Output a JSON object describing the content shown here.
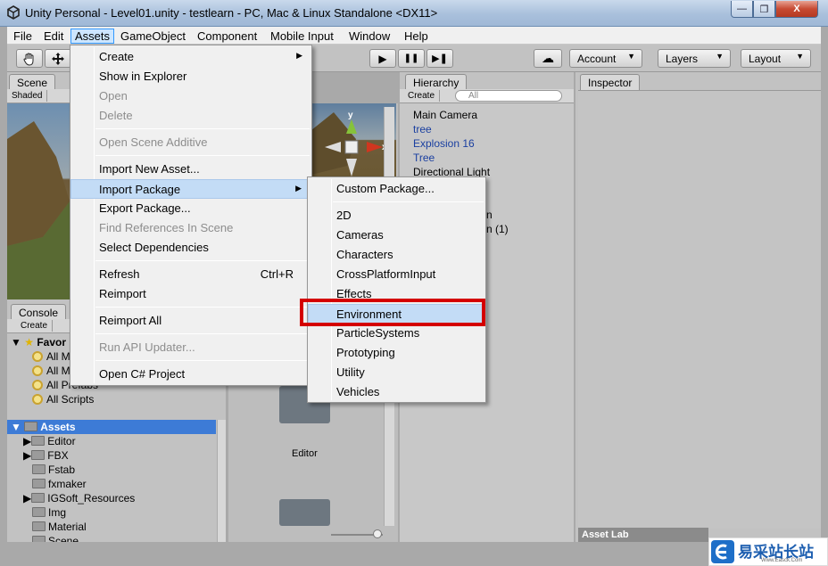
{
  "window": {
    "title": "Unity Personal - Level01.unity - testlearn - PC, Mac & Linux Standalone <DX11>",
    "min_label": "—",
    "max_label": "❐",
    "close_label": "X"
  },
  "menubar": [
    "File",
    "Edit",
    "Assets",
    "GameObject",
    "Component",
    "Mobile Input",
    "Window",
    "Help"
  ],
  "toolbar": {
    "play": "▶",
    "pause": "❚❚",
    "step": "▶❚",
    "cloud": "☁",
    "account": "Account",
    "layers": "Layers",
    "layout": "Layout"
  },
  "scene": {
    "tab": "Scene",
    "mode": "Shaded"
  },
  "gizmo": {
    "y": "y",
    "x": "x"
  },
  "hierarchy": {
    "tab": "Hierarchy",
    "create": "Create",
    "search_placeholder": "All",
    "items": [
      {
        "label": "Main Camera",
        "color": "#000000"
      },
      {
        "label": "tree",
        "color": "#1a3fa0"
      },
      {
        "label": "Explosion 16",
        "color": "#1a3fa0"
      },
      {
        "label": "Tree",
        "color": "#1a3fa0"
      },
      {
        "label": "Directional Light",
        "color": "#000000"
      }
    ],
    "partial": [
      "n",
      "n (1)"
    ]
  },
  "inspector": {
    "tab": "Inspector",
    "asset_labels": "Asset Lab"
  },
  "console": {
    "tab": "Console"
  },
  "project": {
    "create": "Create",
    "favorites": "Favor",
    "favorite_items": [
      "All M",
      "All M",
      "All Prefabs",
      "All Scripts"
    ],
    "assets_root": "Assets",
    "folders": [
      "Editor",
      "FBX",
      "Fstab",
      "fxmaker",
      "IGSoft_Resources",
      "Img",
      "Material",
      "Scene"
    ],
    "grid_item": "Editor"
  },
  "assets_menu": {
    "items": [
      {
        "label": "Create",
        "submenu": true
      },
      {
        "label": "Show in Explorer"
      },
      {
        "label": "Open",
        "disabled": true
      },
      {
        "label": "Delete",
        "disabled": true
      },
      {
        "label": "Open Scene Additive",
        "disabled": true
      },
      {
        "label": "Import New Asset..."
      },
      {
        "label": "Import Package",
        "submenu": true,
        "highlighted": true
      },
      {
        "label": "Export Package..."
      },
      {
        "label": "Find References In Scene",
        "disabled": true
      },
      {
        "label": "Select Dependencies"
      },
      {
        "label": "Refresh",
        "shortcut": "Ctrl+R"
      },
      {
        "label": "Reimport"
      },
      {
        "label": "Reimport All"
      },
      {
        "label": "Run API Updater...",
        "disabled": true
      },
      {
        "label": "Open C# Project"
      }
    ]
  },
  "import_package_menu": {
    "items": [
      "Custom Package...",
      "2D",
      "Cameras",
      "Characters",
      "CrossPlatformInput",
      "Effects",
      "Environment",
      "ParticleSystems",
      "Prototyping",
      "Utility",
      "Vehicles"
    ],
    "highlighted": "Environment"
  },
  "watermark": {
    "text": "易采站长站",
    "sub": "Www.Easck.Com"
  },
  "colors": {
    "highlight_box": "#d40000",
    "menu_hover": "#c3dcf6",
    "selection": "#3d7bd6"
  }
}
